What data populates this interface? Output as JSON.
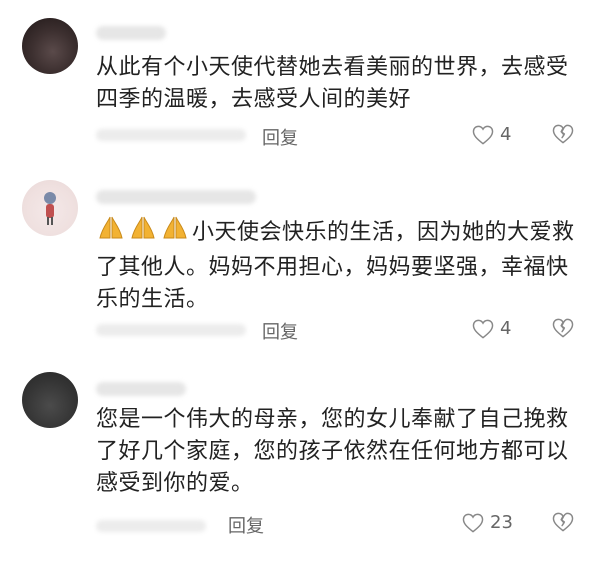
{
  "comments": [
    {
      "text": "从此有个小天使代替她去看美丽的世界，去感受四季的温暖，去感受人间的美好",
      "reply_label": "回复",
      "like_count": "4"
    },
    {
      "emoji": "🙏🙏🙏",
      "text": "小天使会快乐的生活，因为她的大爱救了其他人。妈妈不用担心，妈妈要坚强，幸福快乐的生活。",
      "reply_label": "回复",
      "like_count": "4"
    },
    {
      "text": "您是一个伟大的母亲，您的女儿奉献了自己挽救了好几个家庭，您的孩子依然在任何地方都可以感受到你的爱。",
      "reply_label": "回复",
      "like_count": "23"
    }
  ],
  "icons": {
    "like": "heart-outline-icon",
    "dislike": "broken-heart-icon",
    "emoji": "folded-hands-icon"
  },
  "colors": {
    "text": "#222222",
    "meta": "#666666",
    "icon": "#888888"
  }
}
